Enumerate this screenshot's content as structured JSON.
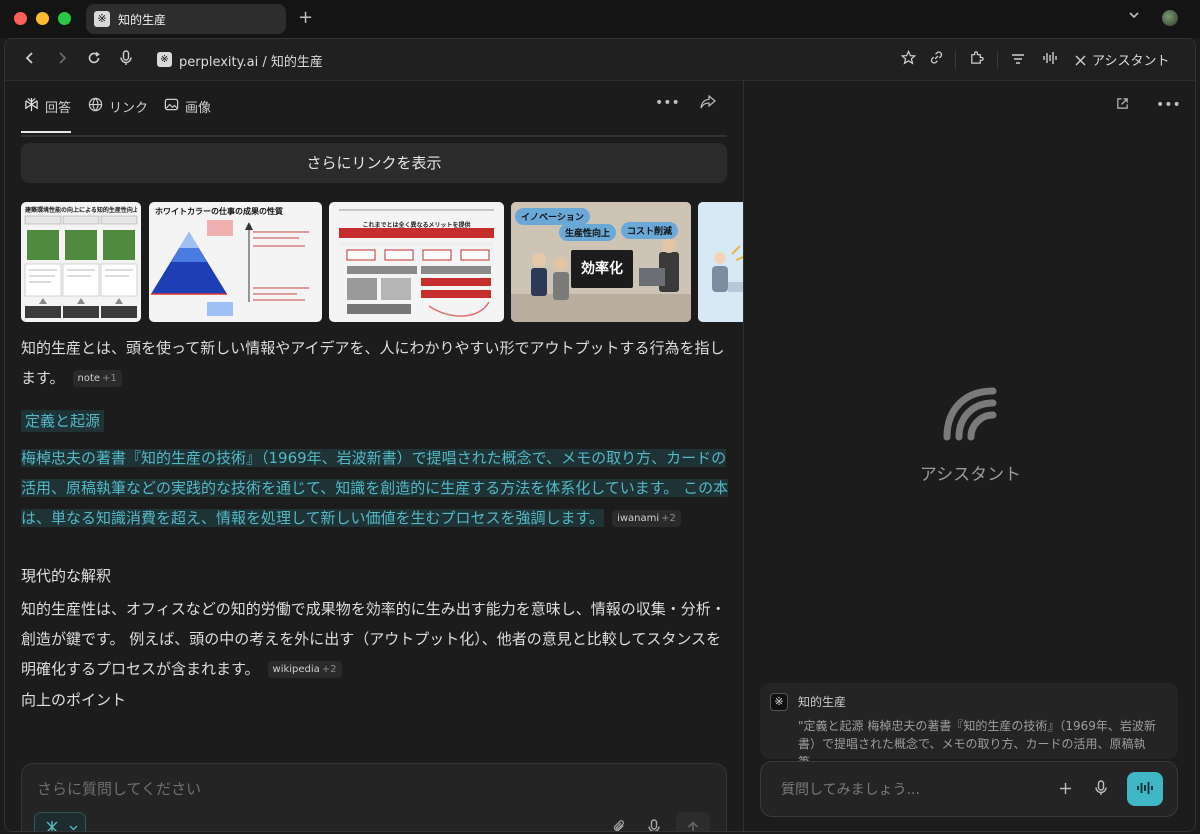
{
  "browser": {
    "tab_title": "知的生産",
    "favicon_glyph": "※",
    "new_tab": "+",
    "url": "perplexity.ai / 知的生産",
    "assistant_button": "アシスタント"
  },
  "left_pane": {
    "tabs": [
      {
        "label": "回答",
        "icon": "perplexity-icon",
        "active": true
      },
      {
        "label": "リンク",
        "icon": "globe-icon"
      },
      {
        "label": "画像",
        "icon": "image-icon"
      }
    ],
    "show_more_links": "さらにリンクを表示",
    "thumbnails": {
      "t1_heading": "建築環境性能の向上による知的生産性向上",
      "t2_heading": "ホワイトカラーの仕事の成果の性質",
      "t3_heading": "これまでとは全く異なるメリットを提供",
      "t4_bubbles": [
        "イノベーション",
        "生産性向上",
        "コスト削減"
      ],
      "t4_sign": "効率化"
    },
    "paragraph_intro": "知的生産とは、頭を使って新しい情報やアイデアを、人にわかりやすい形でアウトプットする行為を指します。",
    "intro_chip": {
      "source": "note",
      "count": "+1"
    },
    "section_origin": "定義と起源",
    "paragraph_origin": "梅棹忠夫の著書『知的生産の技術』（1969年、岩波新書）で提唱された概念で、メモの取り方、カードの活用、原稿執筆などの実践的な技術を通じて、知識を創造的に生産する方法を体系化しています。 この本は、単なる知識消費を超え、情報を処理して新しい価値を生むプロセスを強調します。",
    "origin_chip": {
      "source": "iwanami",
      "count": "+2"
    },
    "section_modern": "現代的な解釈",
    "paragraph_modern": "知的生産性は、オフィスなどの知的労働で成果物を効率的に生み出す能力を意味し、情報の収集・分析・創造が鍵です。 例えば、頭の中の考えを外に出す（アウトプット化）、他者の意見と比較してスタンスを明確化するプロセスが含まれます。",
    "modern_chip": {
      "source": "wikipedia",
      "count": "+2"
    },
    "section_points": "向上のポイント",
    "ask_placeholder": "さらに質問してください"
  },
  "right_pane": {
    "assistant_label": "アシスタント",
    "context_title": "知的生産",
    "context_body": "\"定義と起源 梅棹忠夫の著書『知的生産の技術』（1969年、岩波新書）で提唱された概念で、メモの取り方、カードの活用、原稿執筆...",
    "ask_placeholder": "質問してみましょう..."
  },
  "colors": {
    "accent": "#3fb7c4",
    "highlight_text": "#53b8c4",
    "highlight_bg": "#1f3337",
    "background": "#1c1c1c"
  }
}
